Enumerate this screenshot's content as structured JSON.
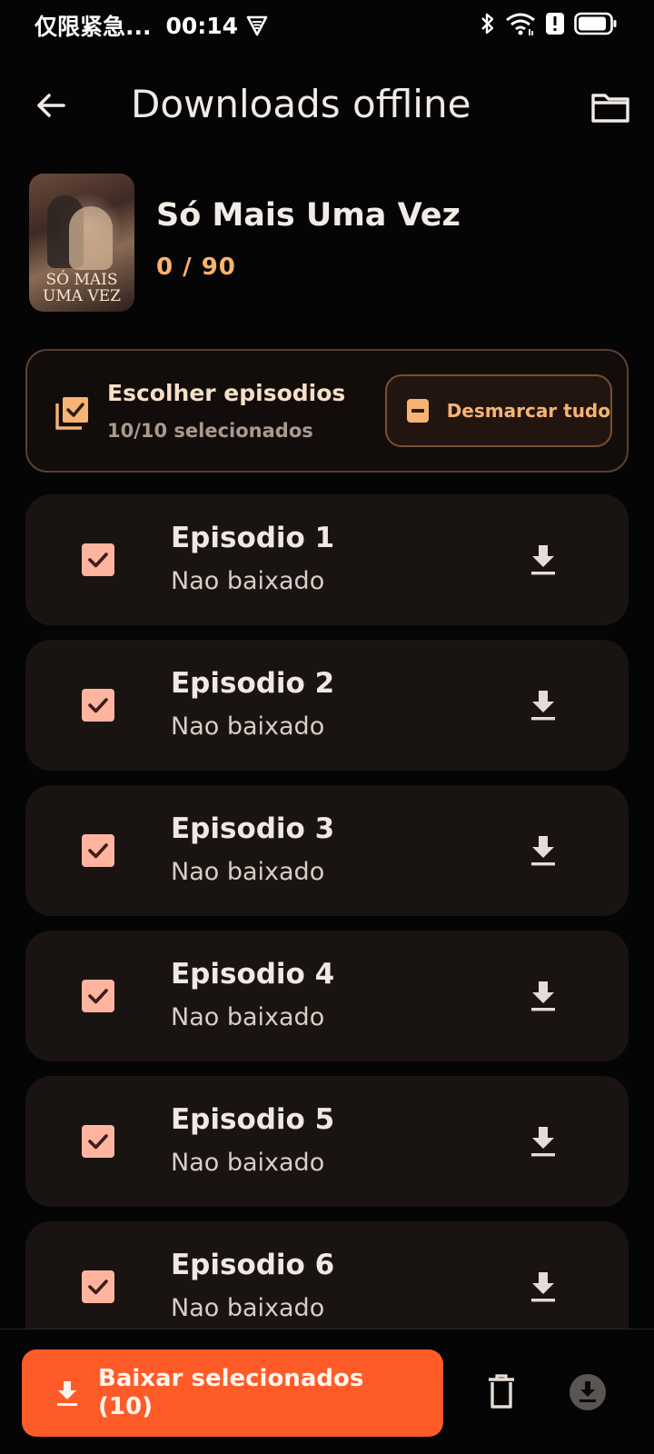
{
  "status_bar": {
    "notification_text": "仅限紧急...",
    "time": "00:14",
    "icons": [
      "vpn-icon",
      "bluetooth-icon",
      "wifi-icon",
      "alert-icon",
      "battery-icon"
    ]
  },
  "header": {
    "title": "Downloads offline",
    "back_icon": "arrow-left-icon",
    "folder_icon": "folder-icon"
  },
  "series": {
    "title": "Só Mais Uma Vez",
    "progress": "0 / 90",
    "poster_text": "SÓ MAIS\nUMA VEZ"
  },
  "selection": {
    "title": "Escolher episodios",
    "count": "10/10 selecionados",
    "deselect_label": "Desmarcar tudo"
  },
  "episodes": [
    {
      "title": "Episodio 1",
      "status": "Nao baixado",
      "checked": true
    },
    {
      "title": "Episodio 2",
      "status": "Nao baixado",
      "checked": true
    },
    {
      "title": "Episodio 3",
      "status": "Nao baixado",
      "checked": true
    },
    {
      "title": "Episodio 4",
      "status": "Nao baixado",
      "checked": true
    },
    {
      "title": "Episodio 5",
      "status": "Nao baixado",
      "checked": true
    },
    {
      "title": "Episodio 6",
      "status": "Nao baixado",
      "checked": true
    }
  ],
  "footer": {
    "download_label": "Baixar selecionados (10)"
  },
  "colors": {
    "accent": "#ff5b28",
    "highlight": "#ffb36b",
    "checkbox": "#ffb4a0",
    "card": "#191412",
    "background": "#050505"
  }
}
